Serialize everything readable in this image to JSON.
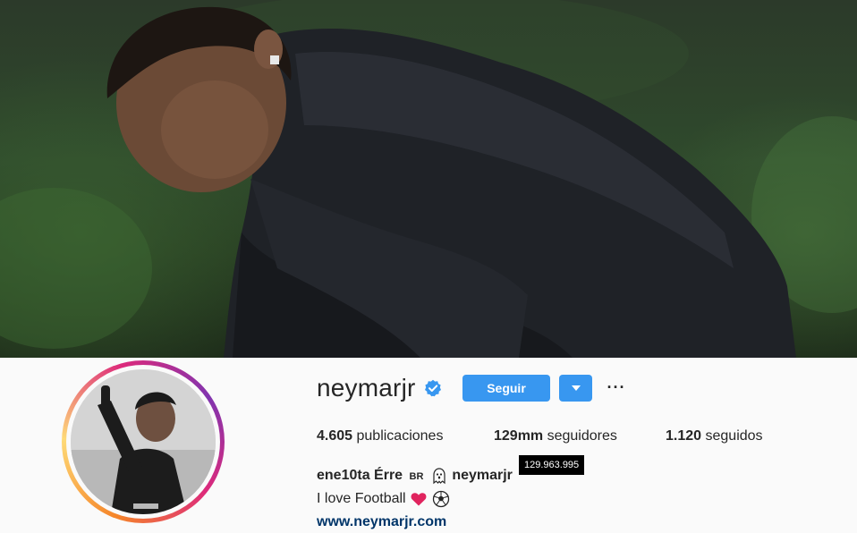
{
  "profile": {
    "username": "neymarjr",
    "verified": true,
    "follow_label": "Seguir",
    "more_label": "···"
  },
  "stats": {
    "posts_count": "4.605",
    "posts_label": "publicaciones",
    "followers_count": "129mm",
    "followers_label": "seguidores",
    "following_count": "1.120",
    "following_label": "seguidos"
  },
  "tooltip": {
    "text": "129.963.995"
  },
  "bio": {
    "name_part1": "ene10ta Érre",
    "name_flag": "BR",
    "name_part2": "neymarjr",
    "text": "I love Football",
    "link": "www.neymarjr.com"
  },
  "colors": {
    "accent": "#3897f0",
    "verified": "#3897f0",
    "link": "#003569",
    "tooltip_bg": "#000000"
  }
}
